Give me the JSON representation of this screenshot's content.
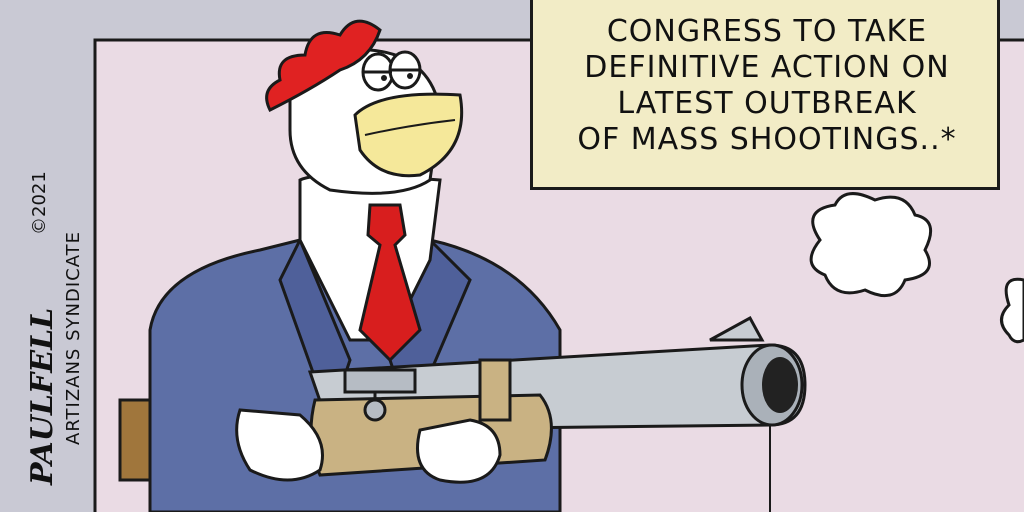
{
  "caption": {
    "lines": [
      "CONGRESS TO TAKE",
      "DEFINITIVE ACTION ON",
      "LATEST OUTBREAK",
      "OF MASS SHOOTINGS..*"
    ]
  },
  "signature": {
    "artist": "PAULFELL",
    "year": "©2021",
    "syndicate": "ARTIZANS SYNDICATE"
  },
  "colors": {
    "wall": "#eadbe4",
    "frame_bg": "#c9c9d4",
    "suit": "#5d6fa6",
    "tie": "#d81e1e",
    "comb": "#e02222",
    "beak": "#f5e89a",
    "gun_metal": "#c7ccd2",
    "gun_stock": "#c9b283"
  }
}
